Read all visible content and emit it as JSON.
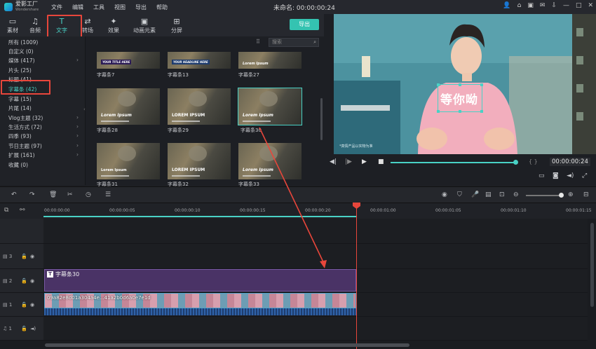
{
  "titlebar": {
    "app_name": "爱影工厂",
    "app_sub": "Wondershare",
    "menu": [
      "文件",
      "编辑",
      "工具",
      "视图",
      "导出",
      "帮助"
    ],
    "window_title": "未命名: 00:00:00:24"
  },
  "tabs": [
    {
      "label": "素材",
      "icon": "folder-icon"
    },
    {
      "label": "音频",
      "icon": "music-icon"
    },
    {
      "label": "文字",
      "icon": "text-icon",
      "active": true
    },
    {
      "label": "转场",
      "icon": "transition-icon"
    },
    {
      "label": "效果",
      "icon": "effects-icon"
    },
    {
      "label": "动画元素",
      "icon": "image-icon"
    },
    {
      "label": "分屏",
      "icon": "split-screen-icon"
    }
  ],
  "export_label": "导出",
  "categories": [
    {
      "label": "所有 (1009)"
    },
    {
      "label": "自定义 (0)"
    },
    {
      "label": "媒体 (417)",
      "arrow": true
    },
    {
      "label": "片头 (25)"
    },
    {
      "label": "标题 (41)"
    },
    {
      "label": "字幕条 (42)",
      "active": true
    },
    {
      "label": "字幕 (15)"
    },
    {
      "label": "片尾 (14)"
    },
    {
      "label": "Vlog主题 (32)",
      "arrow": true
    },
    {
      "label": "生活方式 (72)",
      "arrow": true
    },
    {
      "label": "四季 (93)",
      "arrow": true
    },
    {
      "label": "节日主题 (97)",
      "arrow": true
    },
    {
      "label": "扩展 (161)",
      "arrow": true
    },
    {
      "label": "收藏 (0)"
    }
  ],
  "search_placeholder": "搜索",
  "grid_items": [
    {
      "label": "字幕条7",
      "overlay": "YOUR TITLE HERE"
    },
    {
      "label": "字幕条13",
      "overlay": "YOUR HEADLINE HERE"
    },
    {
      "label": "字幕条27",
      "overlay": "Lorem Ipsum"
    },
    {
      "label": "字幕条28",
      "overlay": "Lorem Ipsum"
    },
    {
      "label": "字幕条29",
      "overlay": "LOREM IPSUM"
    },
    {
      "label": "字幕条30",
      "overlay": "Lorem Ipsum",
      "selected": true
    },
    {
      "label": "字幕条31",
      "overlay": "Lorem Ipsum"
    },
    {
      "label": "字幕条32",
      "overlay": "LOREM IPSUM"
    },
    {
      "label": "字幕条33",
      "overlay": "Lorem Ipsum"
    }
  ],
  "preview": {
    "caption": "等你呦",
    "watermark": "*真情产品以实物为准",
    "timecode": "00:00:00:24"
  },
  "ruler": [
    "00:00:00:00",
    "00:00:00:05",
    "00:00:00:10",
    "00:00:00:15",
    "00:00:00:20",
    "00:00:01:00",
    "00:00:01:05",
    "00:00:01:10",
    "00:00:01:15"
  ],
  "tracks": [
    {
      "num": "3"
    },
    {
      "num": "2"
    },
    {
      "num": "1"
    },
    {
      "num": "1"
    }
  ],
  "text_clip_label": "字幕条30",
  "video_clip_label": "09a82e8d01a304a4e...41a2b0d6a0e7e1d",
  "colors": {
    "accent": "#49d1c5",
    "playhead": "#e8463b",
    "annotation": "#e8463b"
  }
}
